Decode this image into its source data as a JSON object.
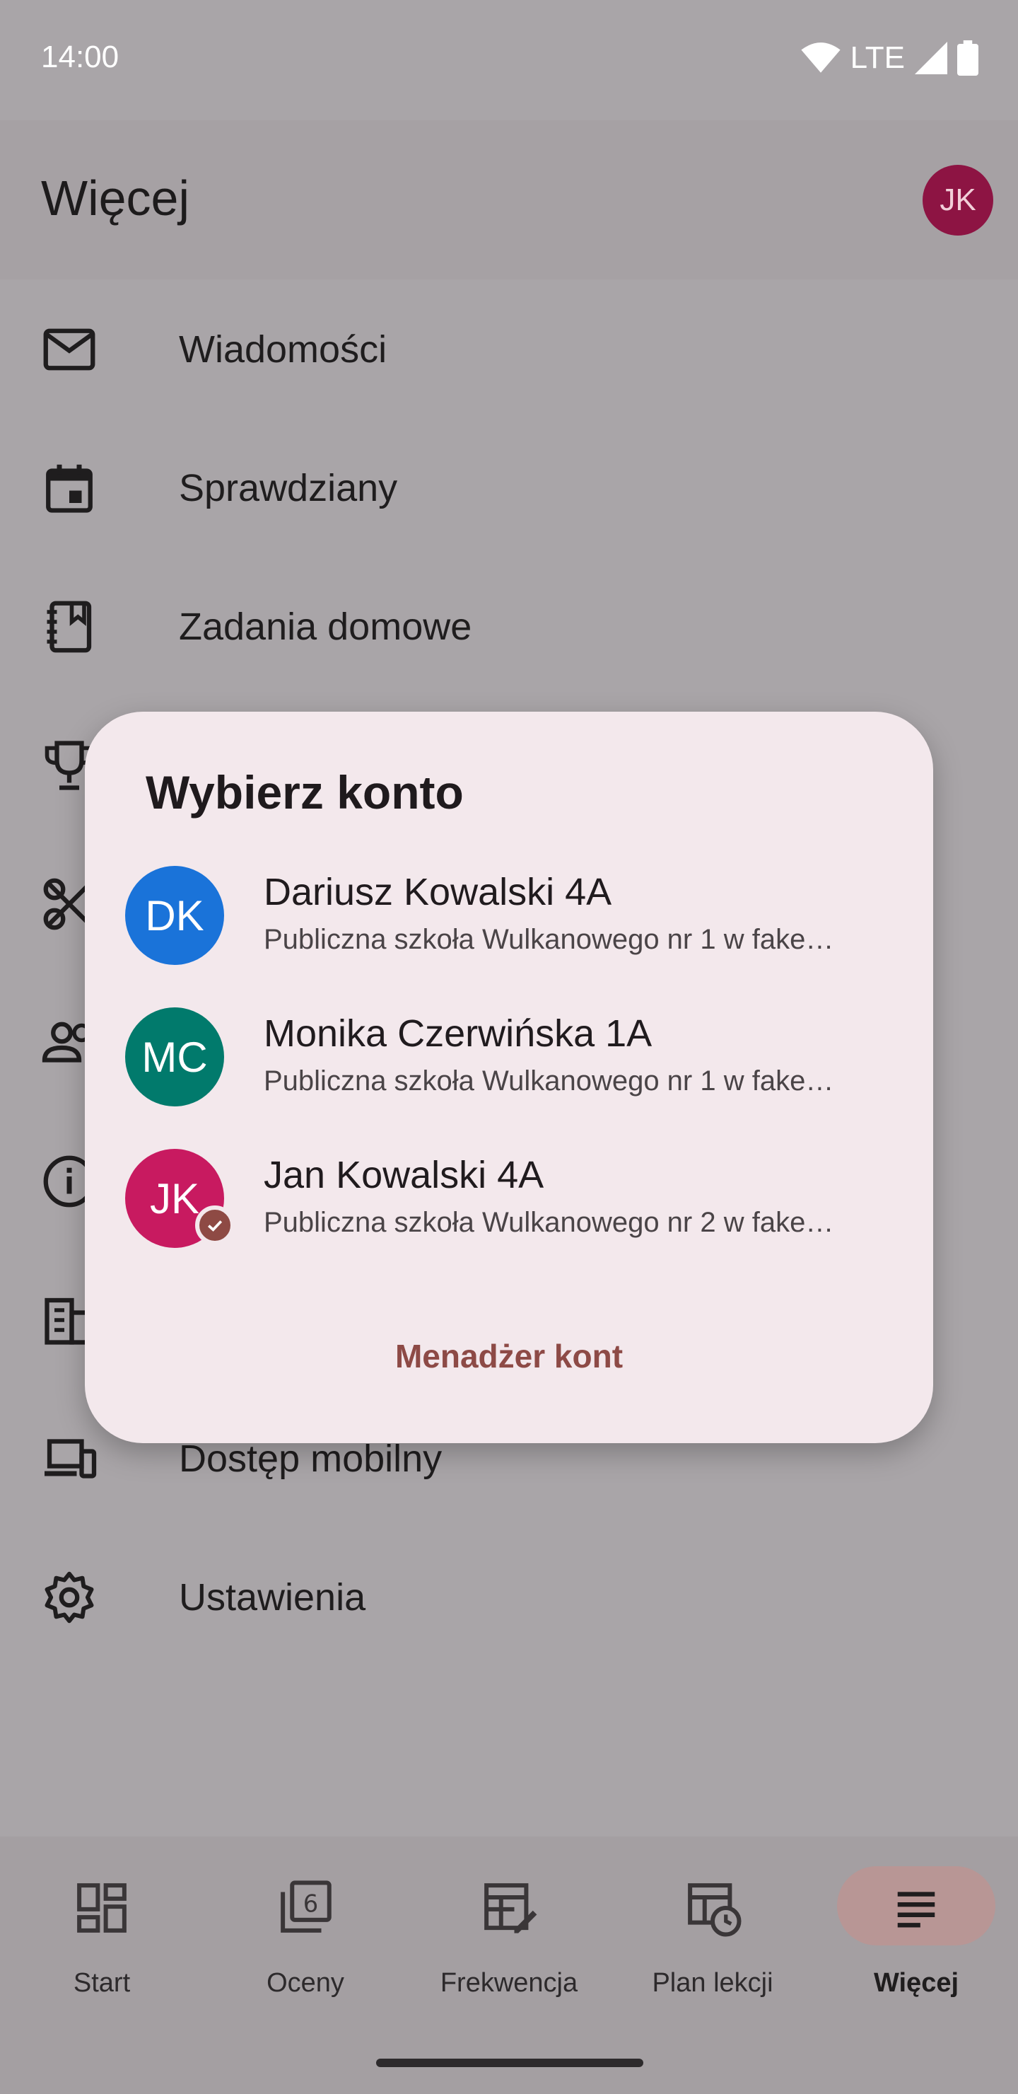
{
  "status_bar": {
    "time": "14:00",
    "network": "LTE"
  },
  "app_bar": {
    "title": "Więcej",
    "avatar_initials": "JK"
  },
  "menu": [
    {
      "label": "Wiadomości",
      "icon": "mail-icon"
    },
    {
      "label": "Sprawdziany",
      "icon": "calendar-icon"
    },
    {
      "label": "Zadania domowe",
      "icon": "homework-book-icon"
    },
    {
      "label": "",
      "icon": "trophy-icon"
    },
    {
      "label": "",
      "icon": "clover-icon"
    },
    {
      "label": "",
      "icon": "people-icon"
    },
    {
      "label": "",
      "icon": "info-icon"
    },
    {
      "label": "",
      "icon": "building-icon"
    },
    {
      "label": "Dostęp mobilny",
      "icon": "devices-icon"
    },
    {
      "label": "Ustawienia",
      "icon": "gear-icon"
    }
  ],
  "dialog": {
    "title": "Wybierz konto",
    "accounts": [
      {
        "initials": "DK",
        "name": "Dariusz Kowalski 4A",
        "school": "Publiczna szkoła Wulkanowego nr 1 w fake…",
        "color": "#1a73d9",
        "selected": false
      },
      {
        "initials": "MC",
        "name": "Monika Czerwińska 1A",
        "school": "Publiczna szkoła Wulkanowego nr 1 w fake…",
        "color": "#017a6c",
        "selected": false
      },
      {
        "initials": "JK",
        "name": "Jan Kowalski 4A",
        "school": "Publiczna szkoła Wulkanowego nr 2 w fake…",
        "color": "#c81a60",
        "selected": true
      }
    ],
    "manager_button": "Menadżer kont"
  },
  "bottom_nav": [
    {
      "label": "Start",
      "icon": "dashboard-icon",
      "active": false
    },
    {
      "label": "Oceny",
      "icon": "grades-icon",
      "active": false
    },
    {
      "label": "Frekwencja",
      "icon": "attendance-icon",
      "active": false
    },
    {
      "label": "Plan lekcji",
      "icon": "timetable-icon",
      "active": false
    },
    {
      "label": "Więcej",
      "icon": "more-icon",
      "active": true
    }
  ],
  "colors": {
    "accent": "#8d4a46",
    "scrim": "#a9a5a8",
    "dialog_bg": "#f3e8ec"
  }
}
